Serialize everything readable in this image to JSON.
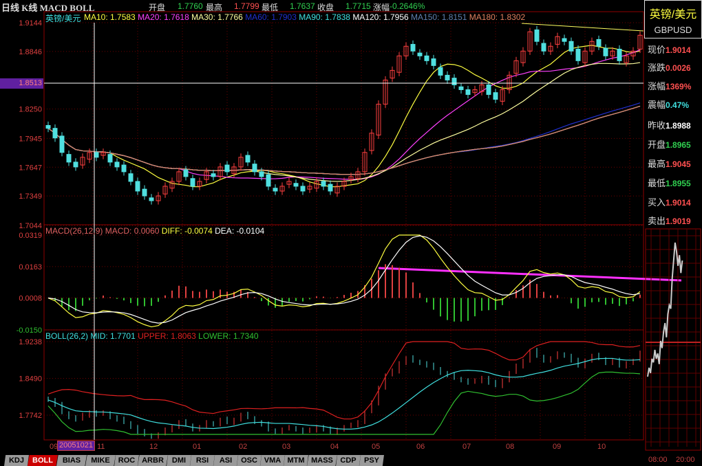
{
  "header": {
    "title": "日线 K线 MACD BOLL",
    "open_label": "开盘",
    "open": "1.7760",
    "high_label": "最高",
    "high": "1.7799",
    "low_label": "最低",
    "low": "1.7637",
    "close_label": "收盘",
    "close": "1.7715",
    "chg_label": "涨幅",
    "chg": "-0.2646%"
  },
  "legend": {
    "name": "英镑/美元",
    "ma": [
      {
        "t": "MA10: 1.7583",
        "c": "#ffff40"
      },
      {
        "t": "MA20: 1.7618",
        "c": "#ff40ff"
      },
      {
        "t": "MA30: 1.7766",
        "c": "#ffffa0"
      },
      {
        "t": "MA60: 1.7903",
        "c": "#2030d0"
      },
      {
        "t": "MA90: 1.7838",
        "c": "#40e0e0"
      },
      {
        "t": "MA120: 1.7956",
        "c": "#ffffff"
      },
      {
        "t": "MA150: 1.8151",
        "c": "#6080b0"
      },
      {
        "t": "MA180: 1.8302",
        "c": "#e08060"
      }
    ]
  },
  "macd_legend": {
    "name": "MACD(26,12,9)",
    "macd": "MACD: 0.0060",
    "diff": "DIFF: -0.0074",
    "dea": "DEA: -0.0104"
  },
  "boll_legend": {
    "name": "BOLL(26,2)",
    "mid": "MID: 1.7701",
    "upper": "UPPER: 1.8063",
    "lower": "LOWER: 1.7340"
  },
  "crosshair": {
    "price": "1.8513",
    "date": "20051021"
  },
  "right_panel": {
    "name_cn": "英镑/美元",
    "code": "GBPUSD",
    "rows": [
      {
        "label": "现价",
        "value": "1.9014",
        "color": "#ff5050"
      },
      {
        "label": "涨跌",
        "value": "0.0026",
        "color": "#ff5050"
      },
      {
        "label": "涨幅",
        "value": "1369%",
        "color": "#ff5050"
      },
      {
        "label": "震幅",
        "value": "0.47%",
        "color": "#40e0e0"
      },
      {
        "label": "昨收",
        "value": "1.8988",
        "color": "#ffffff"
      },
      {
        "label": "开盘",
        "value": "1.8965",
        "color": "#30d050"
      },
      {
        "label": "最高",
        "value": "1.9045",
        "color": "#ff5050"
      },
      {
        "label": "最低",
        "value": "1.8955",
        "color": "#30d050"
      },
      {
        "label": "买入",
        "value": "1.9014",
        "color": "#ff5050"
      },
      {
        "label": "卖出",
        "value": "1.9019",
        "color": "#ff5050"
      }
    ],
    "intraday_times": [
      "08:00",
      "20:00"
    ]
  },
  "tabs": [
    "KDJ",
    "BOLL",
    "BIAS",
    "MIKE",
    "ROC",
    "ARBR",
    "DMI",
    "RSI",
    "ASI",
    "OSC",
    "VMA",
    "MTM",
    "MASS",
    "CDP",
    "PSY"
  ],
  "active_tab": "BOLL",
  "chart_data": {
    "type": "candlestick",
    "title": "英镑/美元 GBPUSD 日线",
    "x_ticks": [
      "09",
      "11",
      "12",
      "01",
      "02",
      "03",
      "04",
      "05",
      "06",
      "07",
      "08",
      "09",
      "10"
    ],
    "main_y_ticks": [
      "1.9144",
      "1.8846",
      "1.8250",
      "1.7945",
      "1.7647",
      "1.7349",
      "1.7044"
    ],
    "main_ylim": [
      1.7044,
      1.9144
    ],
    "macd_y_ticks": [
      "0.0319",
      "0.0163",
      "0.0008",
      "-0.0150"
    ],
    "macd_ylim": [
      -0.015,
      0.0319
    ],
    "boll_y_ticks": [
      "1.9238",
      "1.8490",
      "1.7742"
    ],
    "boll_ylim": [
      1.735,
      1.9238
    ],
    "closes": [
      1.805,
      1.795,
      1.78,
      1.77,
      1.765,
      1.775,
      1.78,
      1.775,
      1.78,
      1.77,
      1.765,
      1.76,
      1.75,
      1.74,
      1.735,
      1.73,
      1.735,
      1.745,
      1.75,
      1.76,
      1.755,
      1.745,
      1.75,
      1.76,
      1.755,
      1.765,
      1.76,
      1.765,
      1.775,
      1.77,
      1.76,
      1.755,
      1.745,
      1.74,
      1.745,
      1.75,
      1.745,
      1.74,
      1.745,
      1.75,
      1.745,
      1.74,
      1.745,
      1.75,
      1.755,
      1.76,
      1.78,
      1.8,
      1.83,
      1.855,
      1.865,
      1.88,
      1.89,
      1.885,
      1.88,
      1.875,
      1.87,
      1.86,
      1.855,
      1.85,
      1.845,
      1.84,
      1.845,
      1.85,
      1.84,
      1.835,
      1.845,
      1.86,
      1.875,
      1.885,
      1.905,
      1.895,
      1.885,
      1.89,
      1.9,
      1.895,
      1.885,
      1.875,
      1.885,
      1.895,
      1.89,
      1.88,
      1.885,
      1.875,
      1.88,
      1.885,
      1.9014
    ],
    "intraday": [
      0.2,
      0.25,
      0.22,
      0.3,
      0.28,
      0.35,
      0.3,
      0.33,
      0.27,
      0.4,
      0.36,
      0.45,
      0.5,
      0.42,
      0.55,
      0.6,
      0.58,
      0.75,
      0.85,
      0.95,
      0.9,
      0.82,
      0.88,
      0.78,
      0.85
    ]
  }
}
